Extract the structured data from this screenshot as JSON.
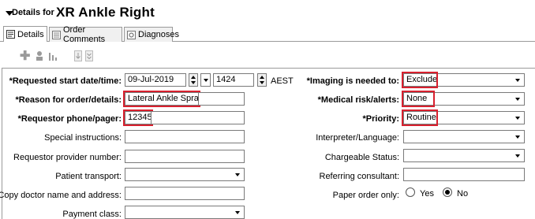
{
  "header": {
    "prefix": "Details for",
    "title": "XR Ankle Right"
  },
  "tabs": [
    {
      "label": "Details",
      "icon": "details-icon"
    },
    {
      "label": "Order Comments",
      "icon": "comments-icon"
    },
    {
      "label": "Diagnoses",
      "icon": "diagnoses-icon"
    }
  ],
  "toolbar": {
    "icons": [
      "add-icon",
      "link-icon",
      "chart-icon",
      "move-down-icon",
      "expand-icon"
    ]
  },
  "form": {
    "requested_start": {
      "label": "*Requested start date/time:",
      "date": "09-Jul-2019",
      "time": "1424",
      "tz": "AEST"
    },
    "reason": {
      "label": "*Reason for order/details:",
      "value": "Lateral Ankle Sprain"
    },
    "requestor_phone": {
      "label": "*Requestor phone/pager:",
      "value": "12345"
    },
    "special_instructions": {
      "label": "Special instructions:",
      "value": ""
    },
    "requestor_provider": {
      "label": "Requestor provider number:",
      "value": ""
    },
    "patient_transport": {
      "label": "Patient transport:",
      "value": ""
    },
    "copy_doctor": {
      "label": "Copy doctor name and address:",
      "value": ""
    },
    "payment_class": {
      "label": "Payment class:",
      "value": ""
    },
    "imaging_needed": {
      "label": "*Imaging is needed to:",
      "value": "Exclude"
    },
    "medical_risk": {
      "label": "*Medical risk/alerts:",
      "value": "None"
    },
    "priority": {
      "label": "*Priority:",
      "value": "Routine"
    },
    "interpreter": {
      "label": "Interpreter/Language:",
      "value": ""
    },
    "chargeable": {
      "label": "Chargeable Status:",
      "value": ""
    },
    "referring": {
      "label": "Referring consultant:",
      "value": ""
    },
    "paper_order": {
      "label": "Paper order only:",
      "yes": "Yes",
      "no": "No",
      "selected": "No"
    }
  },
  "colors": {
    "highlight": "#d8202e"
  }
}
